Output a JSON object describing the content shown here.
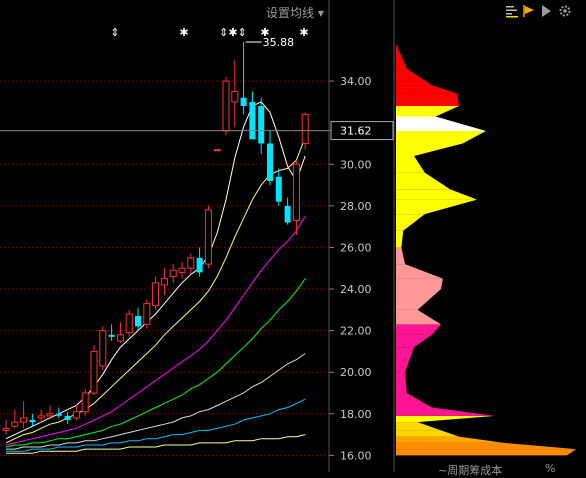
{
  "toolbar": {
    "set_ma_label": "设置均线 ▾"
  },
  "price_axis": {
    "ticks": [
      "34.00",
      "30.00",
      "28.00",
      "26.00",
      "24.00",
      "22.00",
      "20.00",
      "18.00",
      "16.00"
    ],
    "current_label": "31.62"
  },
  "annotations": {
    "high_label": "35.88",
    "event_markers": [
      "⇕",
      "✱",
      "⇕✱⇕",
      "✱",
      "✱"
    ]
  },
  "bottom": {
    "profile_label": "~周期筹成本",
    "right_label": "%"
  },
  "colors": {
    "up": "#ff3030",
    "down": "#00e5ff",
    "grid": "#8b0000"
  },
  "chart_data": {
    "type": "candlestick",
    "ylim": [
      15.2,
      37.9
    ],
    "candles": [
      {
        "o": 17.2,
        "h": 17.7,
        "l": 17.0,
        "c": 17.3
      },
      {
        "o": 17.4,
        "h": 18.2,
        "l": 17.3,
        "c": 17.6
      },
      {
        "o": 17.6,
        "h": 18.6,
        "l": 17.3,
        "c": 17.8
      },
      {
        "o": 17.7,
        "h": 18.0,
        "l": 17.4,
        "c": 17.6
      },
      {
        "o": 17.8,
        "h": 18.2,
        "l": 17.6,
        "c": 17.9
      },
      {
        "o": 17.9,
        "h": 18.4,
        "l": 17.8,
        "c": 18.0
      },
      {
        "o": 18.0,
        "h": 18.3,
        "l": 17.8,
        "c": 17.9
      },
      {
        "o": 17.9,
        "h": 18.1,
        "l": 17.5,
        "c": 17.7
      },
      {
        "o": 17.8,
        "h": 18.5,
        "l": 17.7,
        "c": 18.1
      },
      {
        "o": 18.1,
        "h": 19.2,
        "l": 17.9,
        "c": 19.0
      },
      {
        "o": 19.0,
        "h": 21.3,
        "l": 18.9,
        "c": 21.0
      },
      {
        "o": 20.3,
        "h": 22.2,
        "l": 20.1,
        "c": 22.0
      },
      {
        "o": 21.8,
        "h": 22.3,
        "l": 21.5,
        "c": 21.7
      },
      {
        "o": 21.5,
        "h": 22.4,
        "l": 21.4,
        "c": 21.8
      },
      {
        "o": 21.9,
        "h": 23.0,
        "l": 21.7,
        "c": 22.8
      },
      {
        "o": 22.7,
        "h": 23.1,
        "l": 22.0,
        "c": 22.2
      },
      {
        "o": 22.3,
        "h": 23.5,
        "l": 22.1,
        "c": 23.3
      },
      {
        "o": 23.2,
        "h": 24.6,
        "l": 23.0,
        "c": 24.3
      },
      {
        "o": 24.2,
        "h": 25.0,
        "l": 23.7,
        "c": 24.5
      },
      {
        "o": 24.6,
        "h": 25.2,
        "l": 24.3,
        "c": 24.9
      },
      {
        "o": 24.8,
        "h": 25.3,
        "l": 24.5,
        "c": 25.0
      },
      {
        "o": 25.0,
        "h": 25.7,
        "l": 24.7,
        "c": 25.5
      },
      {
        "o": 25.5,
        "h": 26.0,
        "l": 24.6,
        "c": 24.8
      },
      {
        "o": 25.2,
        "h": 28.0,
        "l": 25.0,
        "c": 27.8
      },
      {
        "o": 30.7,
        "h": 30.7,
        "l": 30.7,
        "c": 30.7
      },
      {
        "o": 31.6,
        "h": 34.2,
        "l": 31.4,
        "c": 34.0
      },
      {
        "o": 33.0,
        "h": 35.0,
        "l": 31.8,
        "c": 33.5
      },
      {
        "o": 33.2,
        "h": 35.88,
        "l": 32.4,
        "c": 32.8
      },
      {
        "o": 33.0,
        "h": 33.5,
        "l": 31.8,
        "c": 31.2
      },
      {
        "o": 32.8,
        "h": 33.2,
        "l": 30.5,
        "c": 31.0
      },
      {
        "o": 31.0,
        "h": 31.6,
        "l": 29.0,
        "c": 29.2
      },
      {
        "o": 29.4,
        "h": 29.8,
        "l": 28.0,
        "c": 28.2
      },
      {
        "o": 28.0,
        "h": 28.4,
        "l": 27.1,
        "c": 27.2
      },
      {
        "o": 27.3,
        "h": 30.2,
        "l": 26.6,
        "c": 30.0
      },
      {
        "o": 31.0,
        "h": 32.5,
        "l": 30.7,
        "c": 32.4
      }
    ],
    "moving_averages": [
      {
        "color": "#ffffff",
        "values": [
          16.8,
          17.0,
          17.2,
          17.4,
          17.6,
          17.8,
          18.0,
          18.2,
          18.4,
          18.8,
          19.3,
          19.9,
          20.6,
          21.2,
          21.6,
          22.0,
          22.4,
          22.8,
          23.3,
          23.8,
          24.3,
          24.7,
          25.0,
          25.6,
          26.7,
          28.3,
          30.3,
          31.8,
          32.8,
          33.0,
          32.5,
          31.3,
          29.9,
          29.2,
          30.4
        ]
      },
      {
        "color": "#ffff66",
        "values": [
          16.6,
          16.8,
          17.0,
          17.1,
          17.3,
          17.5,
          17.6,
          17.8,
          18.0,
          18.2,
          18.5,
          18.9,
          19.3,
          19.7,
          20.1,
          20.5,
          20.9,
          21.3,
          21.8,
          22.2,
          22.6,
          23.0,
          23.4,
          23.9,
          24.6,
          25.5,
          26.5,
          27.4,
          28.3,
          29.0,
          29.5,
          29.7,
          29.8,
          30.2,
          31.3
        ]
      },
      {
        "color": "#ff00ff",
        "values": [
          16.5,
          16.6,
          16.7,
          16.8,
          16.9,
          17.0,
          17.1,
          17.2,
          17.3,
          17.5,
          17.7,
          17.9,
          18.1,
          18.4,
          18.7,
          19.0,
          19.3,
          19.6,
          19.9,
          20.2,
          20.5,
          20.8,
          21.1,
          21.5,
          22.0,
          22.5,
          23.1,
          23.7,
          24.3,
          24.9,
          25.4,
          25.9,
          26.3,
          26.8,
          27.5
        ]
      },
      {
        "color": "#00ff00",
        "values": [
          16.4,
          16.5,
          16.5,
          16.6,
          16.6,
          16.7,
          16.8,
          16.8,
          16.9,
          17.0,
          17.1,
          17.2,
          17.4,
          17.5,
          17.7,
          17.9,
          18.1,
          18.3,
          18.5,
          18.7,
          18.9,
          19.2,
          19.4,
          19.7,
          20.0,
          20.4,
          20.8,
          21.2,
          21.6,
          22.1,
          22.5,
          23.0,
          23.4,
          23.9,
          24.5
        ]
      },
      {
        "color": "#dddddd",
        "values": [
          16.3,
          16.3,
          16.4,
          16.4,
          16.4,
          16.5,
          16.5,
          16.6,
          16.6,
          16.7,
          16.7,
          16.8,
          16.9,
          17.0,
          17.1,
          17.2,
          17.3,
          17.4,
          17.5,
          17.6,
          17.8,
          17.9,
          18.1,
          18.2,
          18.4,
          18.6,
          18.8,
          19.0,
          19.3,
          19.5,
          19.8,
          20.1,
          20.4,
          20.6,
          20.9
        ]
      },
      {
        "color": "#00bfff",
        "values": [
          16.2,
          16.2,
          16.2,
          16.3,
          16.3,
          16.3,
          16.4,
          16.4,
          16.4,
          16.5,
          16.5,
          16.5,
          16.6,
          16.6,
          16.7,
          16.7,
          16.8,
          16.8,
          16.9,
          17.0,
          17.0,
          17.1,
          17.2,
          17.2,
          17.3,
          17.4,
          17.5,
          17.7,
          17.8,
          17.9,
          18.0,
          18.2,
          18.3,
          18.5,
          18.7
        ]
      },
      {
        "color": "#ffff99",
        "values": [
          16.1,
          16.1,
          16.1,
          16.1,
          16.2,
          16.2,
          16.2,
          16.2,
          16.2,
          16.3,
          16.3,
          16.3,
          16.3,
          16.3,
          16.4,
          16.4,
          16.4,
          16.4,
          16.5,
          16.5,
          16.5,
          16.5,
          16.6,
          16.6,
          16.6,
          16.6,
          16.7,
          16.7,
          16.7,
          16.8,
          16.8,
          16.8,
          16.9,
          16.9,
          17.0
        ]
      }
    ],
    "chip_distribution": [
      {
        "price": 16.0,
        "v": 0.95,
        "color": "#ff8c00"
      },
      {
        "price": 16.3,
        "v": 1.0,
        "color": "#ff8c00"
      },
      {
        "price": 16.6,
        "v": 0.6,
        "color": "#ffa500"
      },
      {
        "price": 16.9,
        "v": 0.35,
        "color": "#ffd700"
      },
      {
        "price": 17.2,
        "v": 0.25,
        "color": "#ffd700"
      },
      {
        "price": 17.6,
        "v": 0.12,
        "color": "#ffff00"
      },
      {
        "price": 17.9,
        "v": 0.55,
        "color": "#ff1493"
      },
      {
        "price": 18.3,
        "v": 0.2,
        "color": "#ff1493"
      },
      {
        "price": 19.0,
        "v": 0.06,
        "color": "#ff1493"
      },
      {
        "price": 20.0,
        "v": 0.05,
        "color": "#ff1493"
      },
      {
        "price": 21.2,
        "v": 0.1,
        "color": "#ff1493"
      },
      {
        "price": 21.8,
        "v": 0.2,
        "color": "#ff1493"
      },
      {
        "price": 22.3,
        "v": 0.25,
        "color": "#ff9999"
      },
      {
        "price": 23.0,
        "v": 0.12,
        "color": "#ff9999"
      },
      {
        "price": 24.0,
        "v": 0.25,
        "color": "#ff9999"
      },
      {
        "price": 24.5,
        "v": 0.26,
        "color": "#ff9999"
      },
      {
        "price": 25.2,
        "v": 0.05,
        "color": "#ff9999"
      },
      {
        "price": 26.0,
        "v": 0.03,
        "color": "#ffff00"
      },
      {
        "price": 26.8,
        "v": 0.04,
        "color": "#ffff00"
      },
      {
        "price": 27.6,
        "v": 0.16,
        "color": "#ffff00"
      },
      {
        "price": 28.3,
        "v": 0.45,
        "color": "#ffff00"
      },
      {
        "price": 28.8,
        "v": 0.3,
        "color": "#ffff00"
      },
      {
        "price": 29.6,
        "v": 0.16,
        "color": "#ffff00"
      },
      {
        "price": 30.4,
        "v": 0.1,
        "color": "#ffff00"
      },
      {
        "price": 31.0,
        "v": 0.37,
        "color": "#ffff00"
      },
      {
        "price": 31.6,
        "v": 0.5,
        "color": "#ffffff"
      },
      {
        "price": 32.3,
        "v": 0.22,
        "color": "#ffff00"
      },
      {
        "price": 32.8,
        "v": 0.35,
        "color": "#ff0000"
      },
      {
        "price": 33.4,
        "v": 0.34,
        "color": "#ff0000"
      },
      {
        "price": 33.8,
        "v": 0.2,
        "color": "#ff0000"
      },
      {
        "price": 34.6,
        "v": 0.06,
        "color": "#ff0000"
      },
      {
        "price": 35.4,
        "v": 0.02,
        "color": "#ff0000"
      }
    ]
  }
}
